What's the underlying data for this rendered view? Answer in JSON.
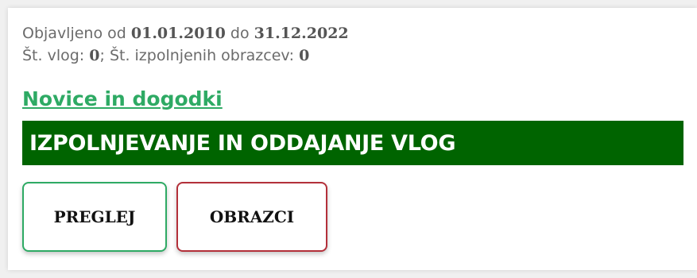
{
  "publication": {
    "prefix": "Objavljeno od",
    "date_from": "01.01.2010",
    "connector": "do",
    "date_to": "31.12.2022"
  },
  "stats": {
    "applications_label": "Št. vlog:",
    "applications_count": "0",
    "forms_label": "Št. izpolnjenih obrazcev:",
    "forms_count": "0"
  },
  "news_link": "Novice in dogodki",
  "banner": {
    "title": "IZPOLNJEVANJE IN ODDAJANJE VLOG",
    "color": "#006400"
  },
  "buttons": {
    "review_label": "PREGLEJ",
    "forms_label": "OBRAZCI",
    "review_border_color": "#2eaa64",
    "forms_border_color": "#b3303a"
  }
}
